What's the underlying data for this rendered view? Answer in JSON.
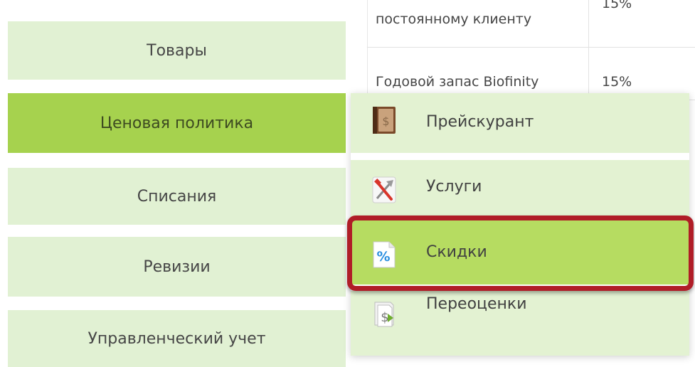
{
  "background_table": {
    "rows": [
      {
        "name": "постоянному клиенту",
        "discount": "15%"
      },
      {
        "name": "Годовой запас Biofinity",
        "discount": "15%"
      }
    ]
  },
  "left_menu": {
    "items": [
      {
        "label": "Товары",
        "active": false
      },
      {
        "label": "Ценовая политика",
        "active": true
      },
      {
        "label": "Списания",
        "active": false
      },
      {
        "label": "Ревизии",
        "active": false
      },
      {
        "label": "Управленческий учет",
        "active": false
      }
    ]
  },
  "submenu": {
    "items": [
      {
        "label": "Прейскурант",
        "icon": "price-book-icon"
      },
      {
        "label": "Услуги",
        "icon": "tools-icon"
      },
      {
        "label": "Скидки",
        "icon": "percent-icon",
        "highlighted": true
      },
      {
        "label": "Переоценки",
        "icon": "revaluation-icon"
      }
    ]
  },
  "colors": {
    "menu_item_bg": "#e1f1d3",
    "menu_item_active_bg": "#a6d24e",
    "submenu_highlight_bg": "#b6dc61",
    "highlight_frame": "#b01d27"
  }
}
